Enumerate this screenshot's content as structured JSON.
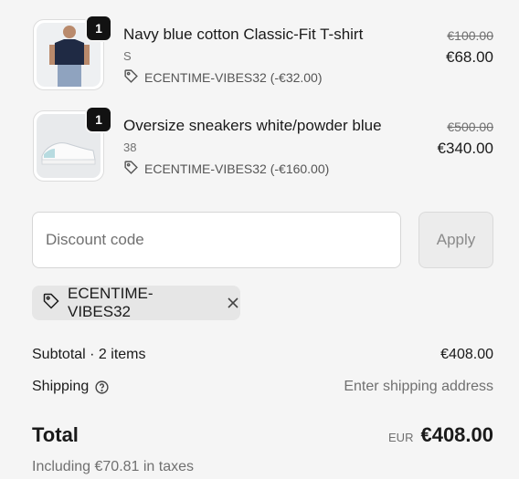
{
  "items": [
    {
      "quantity": "1",
      "name": "Navy blue cotton Classic-Fit T-shirt",
      "variant": "S",
      "discount_label": "ECENTIME-VIBES32 (-€32.00)",
      "original_price": "€100.00",
      "price": "€68.00",
      "icon": "tag-icon"
    },
    {
      "quantity": "1",
      "name": "Oversize sneakers white/powder blue",
      "variant": "38",
      "discount_label": "ECENTIME-VIBES32 (-€160.00)",
      "original_price": "€500.00",
      "price": "€340.00",
      "icon": "tag-icon"
    }
  ],
  "discount": {
    "placeholder": "Discount code",
    "apply_label": "Apply",
    "applied_code": "ECENTIME-VIBES32"
  },
  "summary": {
    "subtotal_label": "Subtotal · 2 items",
    "subtotal_value": "€408.00",
    "shipping_label": "Shipping",
    "shipping_value": "Enter shipping address",
    "total_label": "Total",
    "currency": "EUR",
    "total_value": "€408.00",
    "taxes_note": "Including €70.81 in taxes"
  },
  "colors": {
    "background": "#f5f5f5",
    "badge": "#121212",
    "chip": "#e6e6e6",
    "muted_text": "#707070"
  }
}
